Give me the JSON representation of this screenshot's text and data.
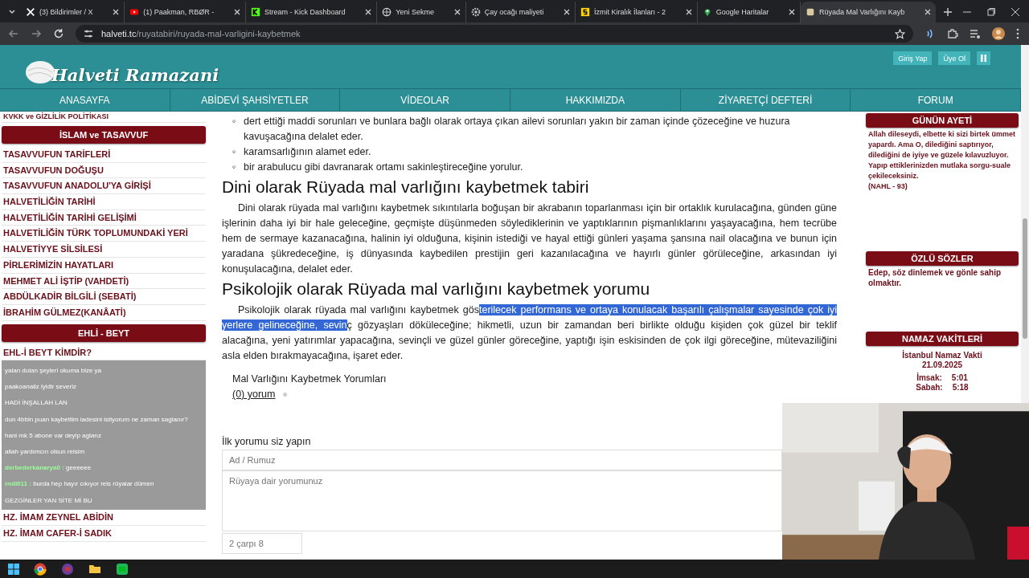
{
  "browser": {
    "tabs": [
      {
        "title": "(3) Bildirimler / X",
        "selected": false
      },
      {
        "title": "(1) Paakman, RBØR -",
        "selected": false
      },
      {
        "title": "Stream - Kick Dashboard",
        "selected": false
      },
      {
        "title": "Yeni Sekme",
        "selected": false
      },
      {
        "title": "Çay ocağı maliyeti",
        "selected": false
      },
      {
        "title": "İzmit Kiralık İlanları - 2",
        "selected": false
      },
      {
        "title": "Google Haritalar",
        "selected": false
      },
      {
        "title": "Rüyada Mal Varlığını Kayb",
        "selected": true
      }
    ],
    "url_host": "halveti.tc",
    "url_path": "/ruyatabiri/ruyada-mal-varligini-kaybetmek"
  },
  "site": {
    "logo": "Halveti Ramazani",
    "login": "Giriş Yap",
    "register": "Üye Ol",
    "nav": [
      "ANASAYFA",
      "ABİDEVİ ŞAHSİYETLER",
      "VİDEOLAR",
      "HAKKIMIZDA",
      "ZİYARETÇİ DEFTERİ",
      "FORUM"
    ]
  },
  "sidebar": [
    {
      "kind": "item",
      "text": "KVKK ve GİZLİLİK POLİTİKASI"
    },
    {
      "kind": "header",
      "text": "İSLAM ve TASAVVUF"
    },
    {
      "kind": "item",
      "text": "TASAVVUFUN TARİFLERİ"
    },
    {
      "kind": "item",
      "text": "TASAVVUFUN DOĞUŞU"
    },
    {
      "kind": "item",
      "text": "TASAVVUFUN ANADOLU'YA GİRİŞİ"
    },
    {
      "kind": "item",
      "text": "HALVETİLİĞİN TARİHİ"
    },
    {
      "kind": "item",
      "text": "HALVETİLİĞİN TARİHİ GELİŞİMİ"
    },
    {
      "kind": "item",
      "text": "HALVETİLİĞİN TÜRK TOPLUMUNDAKİ YERİ"
    },
    {
      "kind": "item",
      "text": "HALVETİYYE SİLSİLESİ"
    },
    {
      "kind": "item",
      "text": "PİRLERİMİZİN HAYATLARI"
    },
    {
      "kind": "item",
      "text": "MEHMET ALİ İŞTİP (VAHDETİ)"
    },
    {
      "kind": "item",
      "text": "ABDÜLKADİR BİLGİLİ (SEBATİ)"
    },
    {
      "kind": "item",
      "text": "İBRAHİM GÜLMEZ(KANÂATİ)"
    },
    {
      "kind": "header",
      "text": "EHLİ - BEYT"
    },
    {
      "kind": "item",
      "text": "EHL-İ BEYT KİMDİR?"
    },
    {
      "kind": "chat"
    },
    {
      "kind": "item",
      "text": "HZ. İMAM ZEYNEL ABİDİN"
    },
    {
      "kind": "item",
      "text": "HZ. İMAM CAFER-İ SADIK"
    }
  ],
  "chat": [
    {
      "text": "yalan dolan şeyleri okuma bize ya"
    },
    {
      "text": "paakoanaliz iyidir severiz"
    },
    {
      "text": "HADİ İNŞALLAH LAN"
    },
    {
      "text": "dun 4bbin puan kaybettim iadesini istiyorum ne zaman saglanır?"
    },
    {
      "text": "hani mk 5 abone var deyip aglarız"
    },
    {
      "text": "allah yardımcın olsun reisim"
    },
    {
      "user": "derbederkanarya0 :",
      "text": "geeeeee"
    },
    {
      "user": "rndi011 :",
      "text": "burda hep hayır cıkıyor reis rüyalar dümen"
    },
    {
      "text": "GEZGİNLER YAN SİTE Mİ BU"
    }
  ],
  "article": {
    "bullets": [
      {
        "marker": "◦",
        "text": "dert ettiği maddi sorunları ve bunlara bağlı olarak ortaya çıkan ailevi sorunları yakın bir zaman içinde çözeceğine ve huzura kavuşacağına delalet eder."
      },
      {
        "marker": "◦",
        "text": "karamsarlığının alamet eder."
      },
      {
        "marker": "◦",
        "text": "bir arabulucu gibi davranarak ortamı sakinleştireceğine yorulur."
      }
    ],
    "sections": [
      {
        "heading": "Dini olarak Rüyada mal varlığını kaybetmek tabiri",
        "parts": [
          {
            "text": "Dini olarak rüyada mal varlığını kaybetmek sıkıntılarla boğuşan bir akrabanın toparlanması için bir ortaklık kurulacağına, günden güne işlerinin daha iyi bir hale geleceğine, geçmişte düşünmeden söylediklerinin ve yaptıklarının pişmanlıklarını yaşayacağına, hem tecrübe hem de sermaye kazanacağına, halinin iyi olduğuna, kişinin istediği ve hayal ettiği günleri yaşama şansına nail olacağına ve bunun için yaradana şükredeceğine, iş dünyasında kaybedilen prestijin geri kazanılacağına ve hayırlı günler görüleceğine, arkasından iyi konuşulacağına, delalet eder.",
            "selected": false
          }
        ]
      },
      {
        "heading": "Psikolojik olarak Rüyada mal varlığını kaybetmek yorumu",
        "parts": [
          {
            "text": "Psikolojik olarak rüyada mal varlığını kaybetmek  gös",
            "selected": false
          },
          {
            "text": "terilecek performans ve ortaya konulacak başarılı çalışmalar sayesinde çok iyi yerlere gelineceğine, sevin",
            "selected": true
          },
          {
            "text": "ç gözyaşları döküleceğine; hikmetli, uzun bir zamandan beri birlikte olduğu kişiden çok güzel bir teklif alacağına, yeni yatırımlar yapacağına, sevinçli ve güzel günler göreceğine, yaptığı işin eskisinden de çok ilgi göreceğine, mütevaziliğini asla elden bırakmayacağına, işaret eder.",
            "selected": false
          }
        ]
      }
    ],
    "comments_title": "Mal Varlığını Kaybetmek Yorumları",
    "comments_count": "(0) yorum",
    "form_title": "İlk yorumu siz yapın",
    "name_placeholder": "Ad / Rumuz",
    "comment_placeholder": "Rüyaya dair yorumunuz",
    "captcha_placeholder": "2 çarpı 8"
  },
  "right": {
    "verse_title": "GÜNÜN AYETİ",
    "verse": "Allah dileseydi, elbette ki sizi birtek ümmet yapardı. Ama O, dilediğini saptırıyor, dilediğini de iyiye ve güzele kılavuzluyor. Yapıp ettiklerinizden mutlaka sorgu-suale çekileceksiniz.",
    "verse_ref": "(NAHL - 93)",
    "saying_title": "ÖZLÜ SÖZLER",
    "saying": "Edep, söz dinlemek ve gönle sahip olmaktır.",
    "prayer_title": "NAMAZ VAKİTLERİ",
    "city": "İstanbul Namaz Vakti",
    "date": "21.09.2025",
    "times": [
      {
        "name": "İmsak:",
        "time": "5:01"
      },
      {
        "name": "Sabah:",
        "time": "5:18"
      }
    ]
  }
}
